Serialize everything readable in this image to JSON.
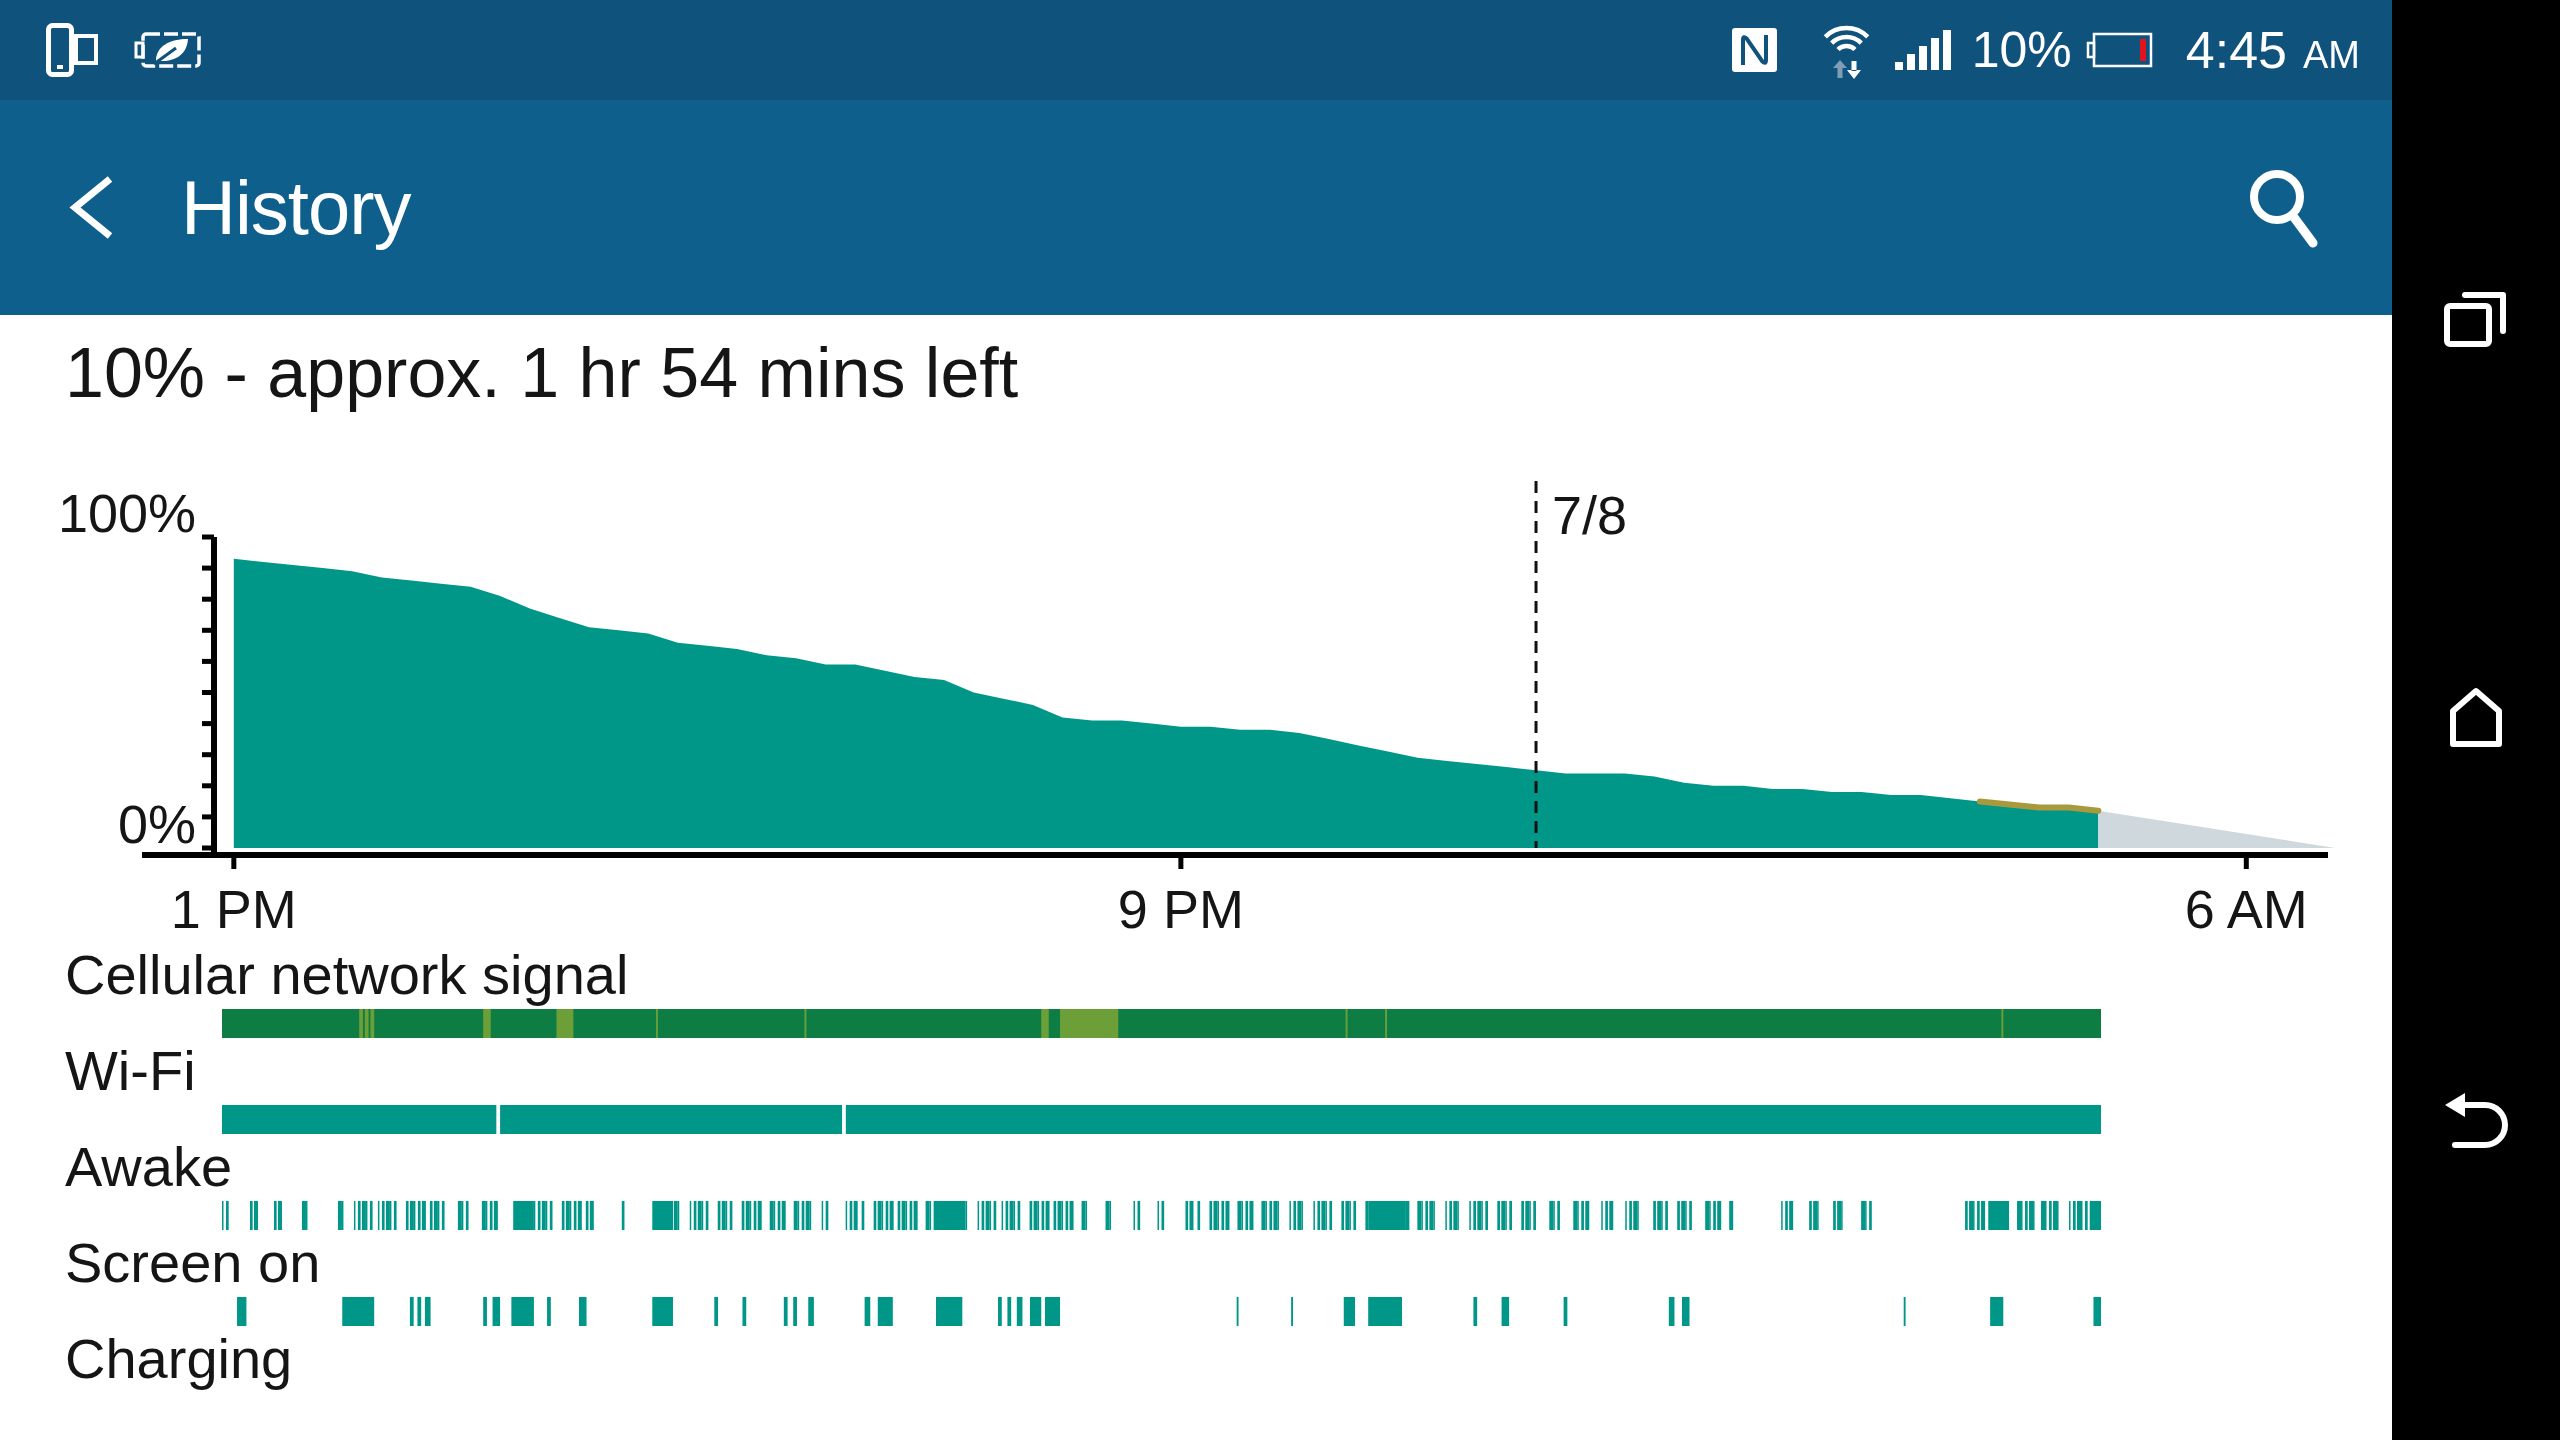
{
  "status_bar": {
    "battery_percent": "10%",
    "time": "4:45",
    "time_period": "AM"
  },
  "app_bar": {
    "title": "History"
  },
  "battery_summary": "10% - approx. 1 hr 54 mins left",
  "chart": {
    "chart_data": {
      "type": "area",
      "categories": [
        "1 PM",
        null,
        null,
        null,
        null,
        null,
        null,
        null,
        null,
        null,
        null,
        null,
        null,
        null,
        null,
        null,
        null,
        null,
        null,
        null,
        null,
        null,
        null,
        null,
        null,
        null,
        null,
        null,
        null,
        null,
        null,
        null,
        "9 PM",
        null,
        null,
        null,
        null,
        null,
        null,
        null,
        null,
        null,
        null,
        null,
        null,
        null,
        null,
        null,
        null,
        null,
        null,
        null,
        null,
        null,
        null,
        null,
        null,
        null,
        null,
        null,
        null,
        null,
        null,
        null,
        null,
        null,
        null,
        null,
        "6 AM",
        null,
        null,
        null
      ],
      "series": [
        {
          "color": "#009688",
          "values": [
            93,
            92,
            91,
            90,
            89,
            87,
            86,
            85,
            84,
            81,
            77,
            74,
            71,
            70,
            69,
            66,
            65,
            64,
            62,
            61,
            59,
            59,
            57,
            55,
            54,
            50,
            48,
            46,
            42,
            41,
            41,
            40,
            39,
            39,
            38,
            38,
            37,
            35,
            33,
            31,
            29,
            28,
            27,
            26,
            25,
            24,
            24,
            24,
            23,
            21,
            20,
            20,
            19,
            19,
            18,
            18,
            17,
            17,
            16,
            15,
            14,
            13,
            13,
            12,
            null,
            null,
            null,
            null,
            null,
            null,
            null,
            null
          ]
        },
        {
          "color": "#cfd8dc",
          "values": [
            null,
            null,
            null,
            null,
            null,
            null,
            null,
            null,
            null,
            null,
            null,
            null,
            null,
            null,
            null,
            null,
            null,
            null,
            null,
            null,
            null,
            null,
            null,
            null,
            null,
            null,
            null,
            null,
            null,
            null,
            null,
            null,
            null,
            null,
            null,
            null,
            null,
            null,
            null,
            null,
            null,
            null,
            null,
            null,
            null,
            null,
            null,
            null,
            null,
            null,
            null,
            null,
            null,
            null,
            null,
            null,
            null,
            null,
            null,
            null,
            null,
            null,
            null,
            12,
            null,
            null,
            null,
            null,
            null,
            null,
            null,
            0
          ]
        },
        {
          "type": "line",
          "color": "#a89a3c",
          "values": [
            null,
            null,
            null,
            null,
            null,
            null,
            null,
            null,
            null,
            null,
            null,
            null,
            null,
            null,
            null,
            null,
            null,
            null,
            null,
            null,
            null,
            null,
            null,
            null,
            null,
            null,
            null,
            null,
            null,
            null,
            null,
            null,
            null,
            null,
            null,
            null,
            null,
            null,
            null,
            null,
            null,
            null,
            null,
            null,
            null,
            null,
            null,
            null,
            null,
            null,
            null,
            null,
            null,
            null,
            null,
            null,
            null,
            null,
            null,
            15,
            14,
            13,
            13,
            12,
            null,
            null,
            null,
            null,
            null,
            null,
            null,
            null
          ]
        }
      ],
      "ylim": [
        0,
        100
      ],
      "yticks": [
        {
          "value": 0,
          "label": "0%"
        },
        {
          "value": 100,
          "label": "100%"
        }
      ],
      "annotations": [
        "7/8"
      ]
    }
  },
  "timelines": [
    {
      "label": "Cellular network signal",
      "kind": "signal"
    },
    {
      "label": "Wi-Fi",
      "kind": "wifi"
    },
    {
      "label": "Awake",
      "kind": "awake"
    },
    {
      "label": "Screen on",
      "kind": "screen"
    },
    {
      "label": "Charging",
      "kind": "charging"
    }
  ]
}
